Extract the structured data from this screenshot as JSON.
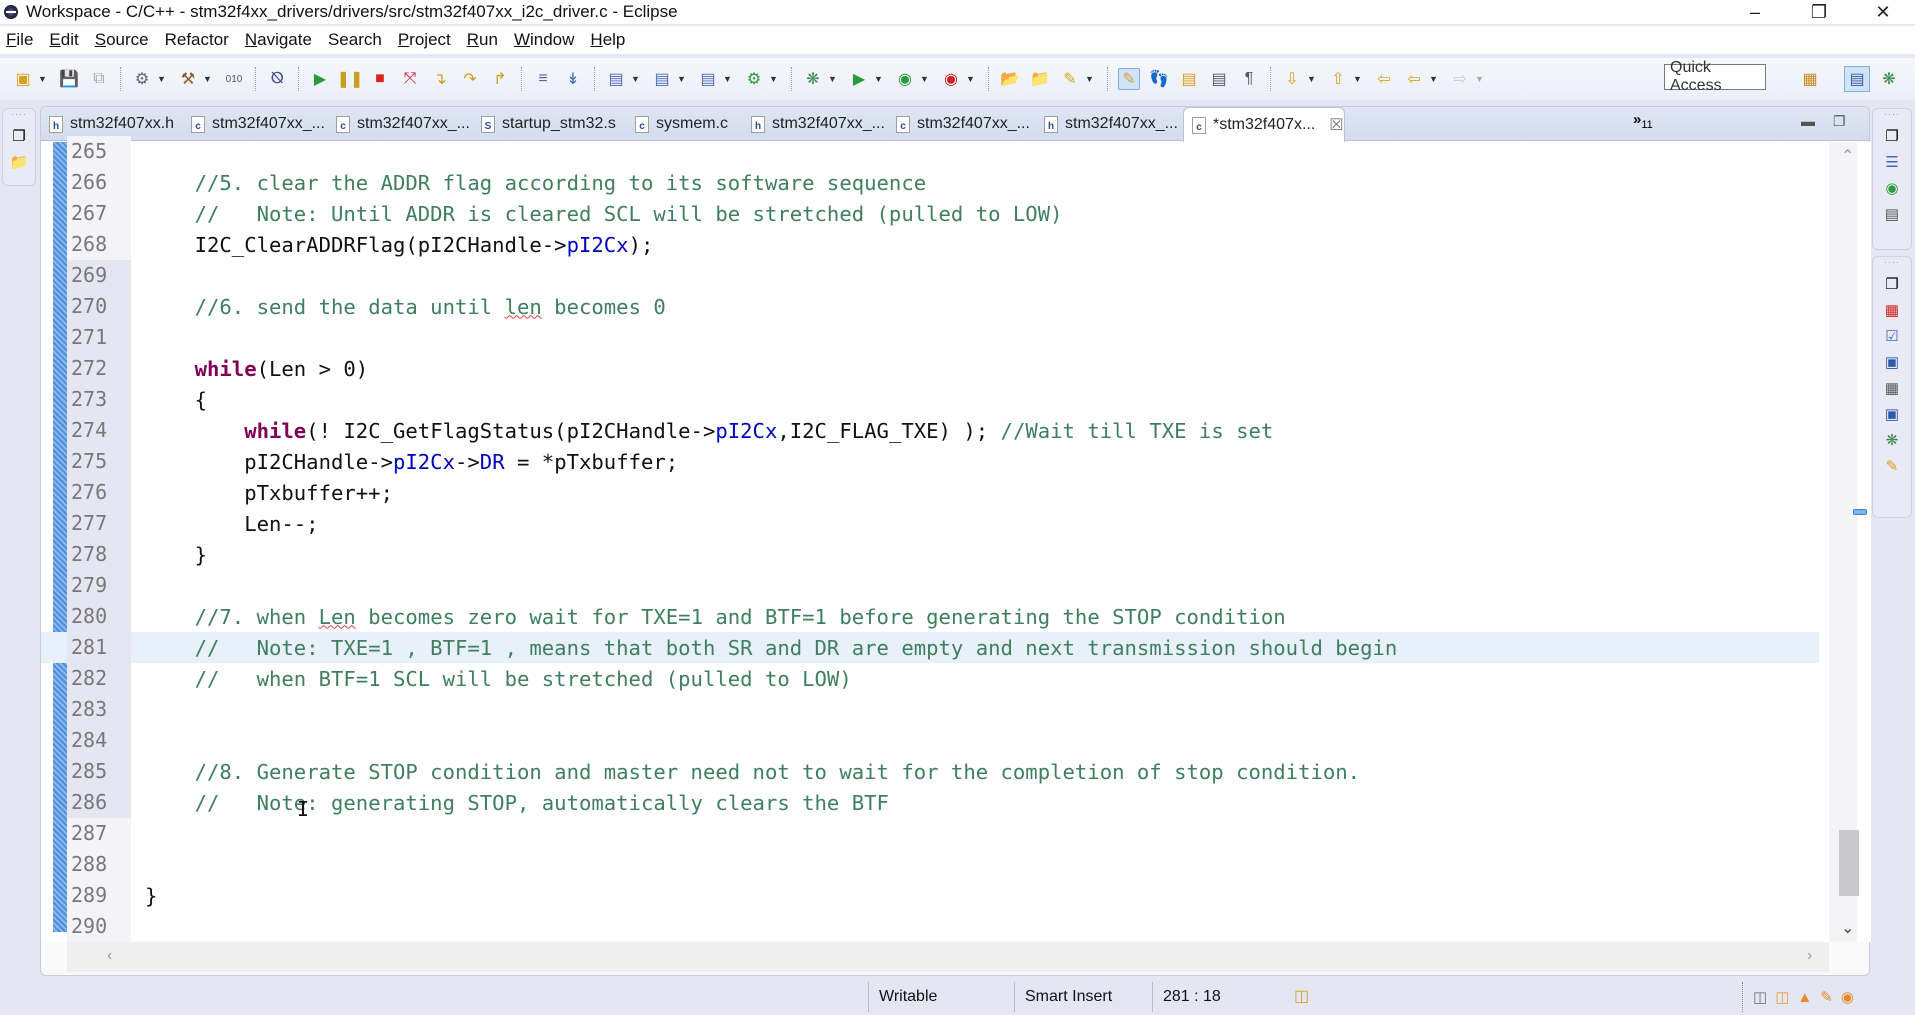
{
  "window": {
    "title": "Workspace - C/C++ - stm32f4xx_drivers/drivers/src/stm32f407xx_i2c_driver.c - Eclipse",
    "controls": [
      "minimize",
      "restore",
      "close"
    ]
  },
  "menu": [
    {
      "label": "File",
      "mnemonic": "F",
      "rest": "ile"
    },
    {
      "label": "Edit",
      "mnemonic": "E",
      "rest": "dit"
    },
    {
      "label": "Source",
      "mnemonic": "S",
      "rest": "ource"
    },
    {
      "label": "Refactor",
      "mnemonic": "",
      "rest": "Refactor"
    },
    {
      "label": "Navigate",
      "mnemonic": "N",
      "rest": "avigate"
    },
    {
      "label": "Search",
      "mnemonic": "",
      "rest": "Search"
    },
    {
      "label": "Project",
      "mnemonic": "P",
      "rest": "roject"
    },
    {
      "label": "Run",
      "mnemonic": "R",
      "rest": "un"
    },
    {
      "label": "Window",
      "mnemonic": "W",
      "rest": "indow"
    },
    {
      "label": "Help",
      "mnemonic": "H",
      "rest": "elp"
    }
  ],
  "toolbar": {
    "quick_access": "Quick Access"
  },
  "tabs": [
    {
      "label": "stm32f407xx.h",
      "type": "h"
    },
    {
      "label": "stm32f407xx_...",
      "type": "c"
    },
    {
      "label": "stm32f407xx_...",
      "type": "c"
    },
    {
      "label": "startup_stm32.s",
      "type": "S"
    },
    {
      "label": "sysmem.c",
      "type": "c"
    },
    {
      "label": "stm32f407xx_...",
      "type": "h"
    },
    {
      "label": "stm32f407xx_...",
      "type": "c"
    },
    {
      "label": "stm32f407xx_...",
      "type": "h"
    },
    {
      "label": "*stm32f407x...",
      "type": "c",
      "active": true
    }
  ],
  "tab_overflow": {
    "symbol": "»",
    "count": "11"
  },
  "editor": {
    "lines": [
      {
        "n": "265",
        "html": ""
      },
      {
        "n": "266",
        "html": "    <span class=\"cm\">//5. clear the ADDR flag according to its software sequence</span>"
      },
      {
        "n": "267",
        "html": "    <span class=\"cm\">//   Note: Until ADDR is cleared SCL will be stretched (pulled to LOW)</span>"
      },
      {
        "n": "268",
        "html": "    I2C_ClearADDRFlag(pI2CHandle-&gt;<span class=\"fld\">pI2Cx</span>);"
      },
      {
        "n": "269",
        "html": ""
      },
      {
        "n": "270",
        "html": "    <span class=\"cm\">//6. send the data until <span class=\"squig\">len</span> becomes 0</span>"
      },
      {
        "n": "271",
        "html": ""
      },
      {
        "n": "272",
        "html": "    <span class=\"kw\">while</span>(Len &gt; 0)"
      },
      {
        "n": "273",
        "html": "    {"
      },
      {
        "n": "274",
        "html": "        <span class=\"kw\">while</span>(! I2C_GetFlagStatus(pI2CHandle-&gt;<span class=\"fld\">pI2Cx</span>,I2C_FLAG_TXE) ); <span class=\"cm\">//Wait till TXE is set</span>"
      },
      {
        "n": "275",
        "html": "        pI2CHandle-&gt;<span class=\"fld\">pI2Cx</span>-&gt;<span class=\"fld\">DR</span> = *pTxbuffer;"
      },
      {
        "n": "276",
        "html": "        pTxbuffer++;"
      },
      {
        "n": "277",
        "html": "        Len--;"
      },
      {
        "n": "278",
        "html": "    }"
      },
      {
        "n": "279",
        "html": ""
      },
      {
        "n": "280",
        "html": "    <span class=\"cm\">//7. when <span class=\"squig\">Len</span> becomes zero wait for TXE=1 and BTF=1 before generating the STOP condition</span>"
      },
      {
        "n": "281",
        "html": "    <span class=\"cm\">//   Note: TXE=1 , BTF=1 , means that both SR and DR are empty and next transmission should begin</span>",
        "current": true
      },
      {
        "n": "282",
        "html": "    <span class=\"cm\">//   when BTF=1 SCL will be stretched (pulled to LOW)</span>"
      },
      {
        "n": "283",
        "html": ""
      },
      {
        "n": "284",
        "html": ""
      },
      {
        "n": "285",
        "html": "    <span class=\"cm\">//8. Generate STOP condition and master need not to wait for the completion of stop condition.</span>"
      },
      {
        "n": "286",
        "html": "    <span class=\"cm\">//   Note: generating STOP, automatically clears the BTF</span>"
      },
      {
        "n": "287",
        "html": ""
      },
      {
        "n": "288",
        "html": ""
      },
      {
        "n": "289",
        "html": "}"
      },
      {
        "n": "290",
        "html": ""
      }
    ]
  },
  "status": {
    "writable": "Writable",
    "insert_mode": "Smart Insert",
    "position": "281 : 18"
  },
  "colors": {
    "keyword": "#7f0055",
    "comment": "#3f7f5f",
    "field": "#0000c0",
    "current_line": "#e8f0fa"
  }
}
